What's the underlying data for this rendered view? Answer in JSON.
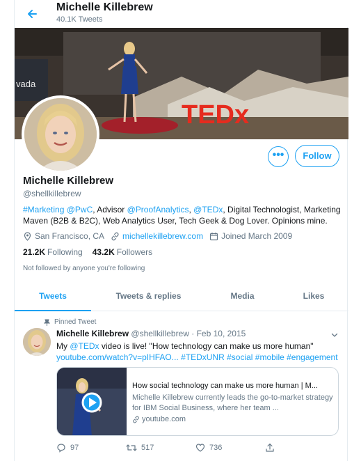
{
  "header": {
    "name": "Michelle Killebrew",
    "tweet_count": "40.1K Tweets"
  },
  "banner": {
    "sign_text": "vada",
    "tedx_text": "TEDx"
  },
  "profile": {
    "name": "Michelle Killebrew",
    "handle": "@shellkillebrew",
    "more_label": "•••",
    "follow_label": "Follow",
    "bio": {
      "l1": "#Marketing",
      "s1": " ",
      "l2": "@PwC",
      "s2": ", Advisor ",
      "l3": "@ProofAnalytics",
      "s3": ", ",
      "l4": "@TEDx",
      "s4": ", Digital Technologist, Marketing Maven (B2B & B2C), Web Analytics User, Tech Geek & Dog Lover. Opinions mine."
    },
    "location": "San Francisco, CA",
    "website": "michellekillebrew.com",
    "joined": "Joined March 2009",
    "following_count": "21.2K",
    "following_label": "Following",
    "followers_count": "43.2K",
    "followers_label": "Followers",
    "not_followed": "Not followed by anyone you're following"
  },
  "tabs": [
    {
      "label": "Tweets"
    },
    {
      "label": "Tweets & replies"
    },
    {
      "label": "Media"
    },
    {
      "label": "Likes"
    }
  ],
  "tweet": {
    "pinned_label": "Pinned Tweet",
    "author": "Michelle Killebrew",
    "handle_date": " @shellkillebrew · Feb 10, 2015",
    "text_a": "My ",
    "text_link": "@TEDx",
    "text_b": " video is live! \"How technology can make us more human\"",
    "text_line2": "youtube.com/watch?v=pIHFAO... #TEDxUNR #social #mobile #engagement",
    "card": {
      "title": "How social technology can make us more human | M...",
      "description": "Michelle Killebrew currently leads the go-to-market strategy for IBM Social Business, where her team ...",
      "domain": "youtube.com"
    },
    "replies": "97",
    "retweets": "517",
    "likes": "736"
  },
  "colors": {
    "accent": "#1da1f2",
    "secondary_text": "#657786",
    "border": "#e6ecf0"
  }
}
